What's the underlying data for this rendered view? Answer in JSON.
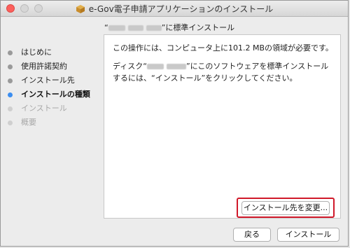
{
  "window": {
    "title": "e-Gov電子申請アプリケーションのインストール"
  },
  "header": {
    "subtitle_prefix": "“",
    "subtitle_suffix": "”に標準インストール"
  },
  "steps": [
    {
      "label": "はじめに",
      "state": "done"
    },
    {
      "label": "使用許諾契約",
      "state": "done"
    },
    {
      "label": "インストール先",
      "state": "done"
    },
    {
      "label": "インストールの種類",
      "state": "current"
    },
    {
      "label": "インストール",
      "state": "future"
    },
    {
      "label": "概要",
      "state": "future"
    }
  ],
  "content": {
    "line1": "この操作には、コンピュータ上に101.2 MBの領域が必要です。",
    "line2_prefix": "ディスク“",
    "line2_suffix": "”にこのソフトウェアを標準インストールするには、“インストール”をクリックしてください。"
  },
  "buttons": {
    "change_location": "インストール先を変更...",
    "back": "戻る",
    "install": "インストール"
  },
  "colors": {
    "current_step": "#3c8ef0",
    "highlight": "#d0192a"
  }
}
